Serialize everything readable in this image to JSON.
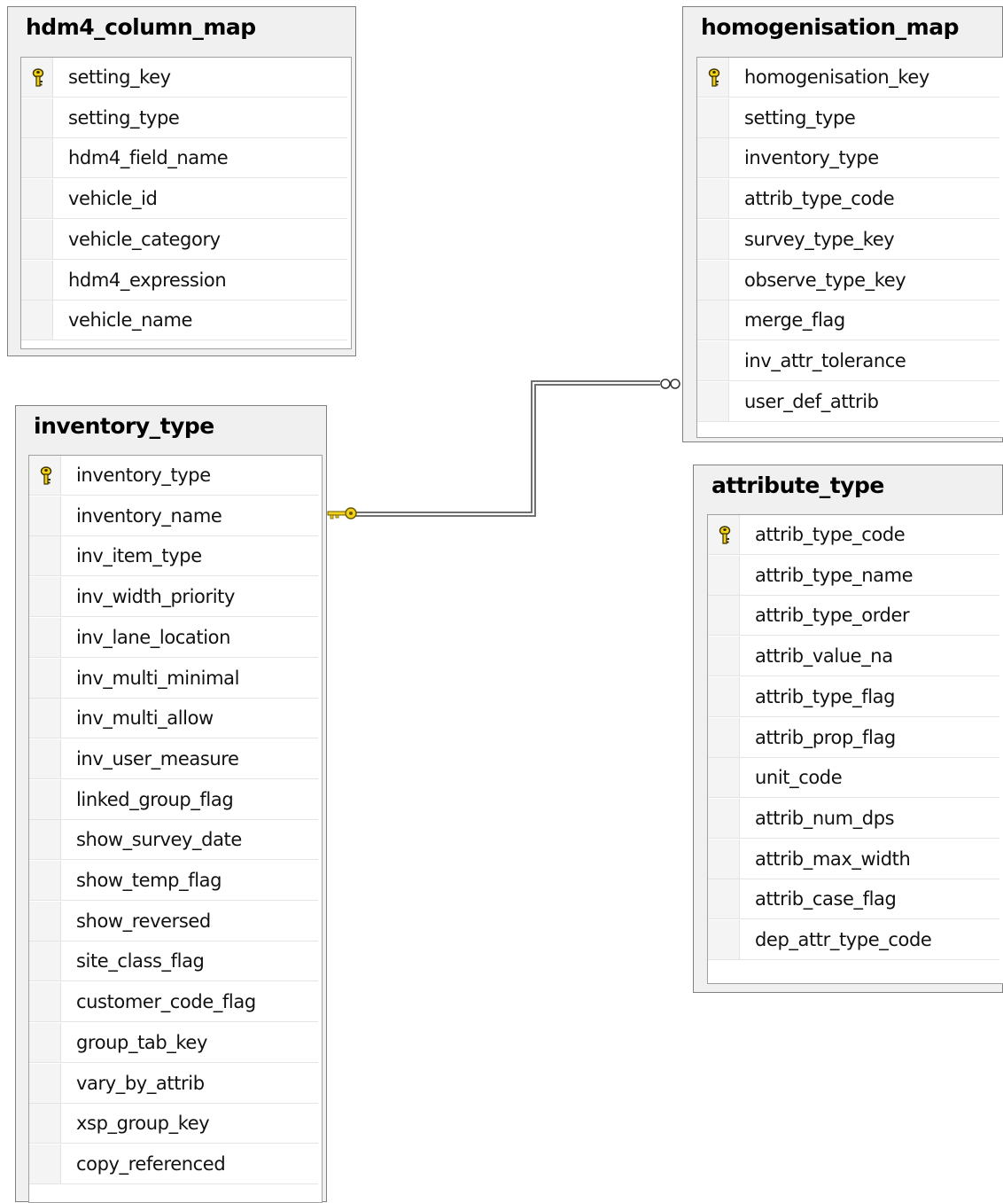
{
  "tables": {
    "hdm4_column_map": {
      "title": "hdm4_column_map",
      "columns": [
        {
          "name": "setting_key",
          "primary_key": true
        },
        {
          "name": "setting_type"
        },
        {
          "name": "hdm4_field_name"
        },
        {
          "name": "vehicle_id"
        },
        {
          "name": "vehicle_category"
        },
        {
          "name": "hdm4_expression"
        },
        {
          "name": "vehicle_name"
        }
      ]
    },
    "homogenisation_map": {
      "title": "homogenisation_map",
      "columns": [
        {
          "name": "homogenisation_key",
          "primary_key": true
        },
        {
          "name": "setting_type"
        },
        {
          "name": "inventory_type"
        },
        {
          "name": "attrib_type_code"
        },
        {
          "name": "survey_type_key"
        },
        {
          "name": "observe_type_key"
        },
        {
          "name": "merge_flag"
        },
        {
          "name": "inv_attr_tolerance"
        },
        {
          "name": "user_def_attrib"
        }
      ]
    },
    "inventory_type": {
      "title": "inventory_type",
      "columns": [
        {
          "name": "inventory_type",
          "primary_key": true
        },
        {
          "name": "inventory_name"
        },
        {
          "name": "inv_item_type"
        },
        {
          "name": "inv_width_priority"
        },
        {
          "name": "inv_lane_location"
        },
        {
          "name": "inv_multi_minimal"
        },
        {
          "name": "inv_multi_allow"
        },
        {
          "name": "inv_user_measure"
        },
        {
          "name": "linked_group_flag"
        },
        {
          "name": "show_survey_date"
        },
        {
          "name": "show_temp_flag"
        },
        {
          "name": "show_reversed"
        },
        {
          "name": "site_class_flag"
        },
        {
          "name": "customer_code_flag"
        },
        {
          "name": "group_tab_key"
        },
        {
          "name": "vary_by_attrib"
        },
        {
          "name": "xsp_group_key"
        },
        {
          "name": "copy_referenced"
        }
      ]
    },
    "attribute_type": {
      "title": "attribute_type",
      "columns": [
        {
          "name": "attrib_type_code",
          "primary_key": true
        },
        {
          "name": "attrib_type_name"
        },
        {
          "name": "attrib_type_order"
        },
        {
          "name": "attrib_value_na"
        },
        {
          "name": "attrib_type_flag"
        },
        {
          "name": "attrib_prop_flag"
        },
        {
          "name": "unit_code"
        },
        {
          "name": "attrib_num_dps"
        },
        {
          "name": "attrib_max_width"
        },
        {
          "name": "attrib_case_flag"
        },
        {
          "name": "dep_attr_type_code"
        }
      ]
    }
  },
  "relationships": [
    {
      "from_table": "inventory_type",
      "from_end": "one-key",
      "to_table": "homogenisation_map",
      "to_end": "many-infinity"
    }
  ],
  "colors": {
    "key_icon": "#f2d21a",
    "connector": "#707070"
  }
}
